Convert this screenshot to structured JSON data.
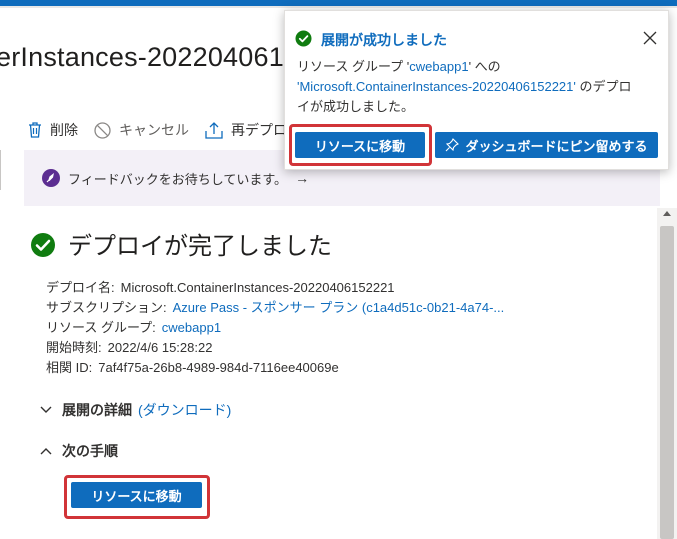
{
  "window": {
    "title": "erInstances-20220406152221"
  },
  "toolbar": {
    "delete_label": "削除",
    "cancel_label": "キャンセル",
    "redeploy_label": "再デプロ"
  },
  "feedback": {
    "text": "フィードバックをお待ちしています。",
    "arrow": "→"
  },
  "deployment": {
    "heading": "デプロイが完了しました",
    "details": [
      {
        "label": "デプロイ名:",
        "value": "Microsoft.ContainerInstances-20220406152221",
        "is_link": false
      },
      {
        "label": "サブスクリプション:",
        "value": "Azure Pass - スポンサー プラン (c1a4d51c-0b21-4a74-...",
        "is_link": true
      },
      {
        "label": "リソース グループ:",
        "value": "cwebapp1",
        "is_link": true
      },
      {
        "label": "開始時刻:",
        "value": "2022/4/6 15:28:22",
        "is_link": false
      },
      {
        "label": "相関 ID:",
        "value": "7af4f75a-26b8-4989-984d-7116ee40069e",
        "is_link": false
      }
    ]
  },
  "sections": {
    "details_label": "展開の詳細",
    "download_label": "(ダウンロード)",
    "next_steps_label": "次の手順",
    "goto_resource_button": "リソースに移動"
  },
  "notification": {
    "title": "展開が成功しました",
    "body_line1_prefix": "リソース グループ '",
    "body_line1_link": "cwebapp1",
    "body_line1_suffix": "' への",
    "body_line2_link": "'Microsoft.ContainerInstances-20220406152221'",
    "body_line2_suffix": " のデプロ",
    "body_line3": "イが成功しました。",
    "goto_resource_button": "リソースに移動",
    "pin_dashboard_button": "ダッシュボードにピン留めする"
  },
  "colors": {
    "accent": "#0f6cbd",
    "success": "#107c10",
    "highlight_outline": "#d13438",
    "feedback_background": "#f3f0f7"
  }
}
